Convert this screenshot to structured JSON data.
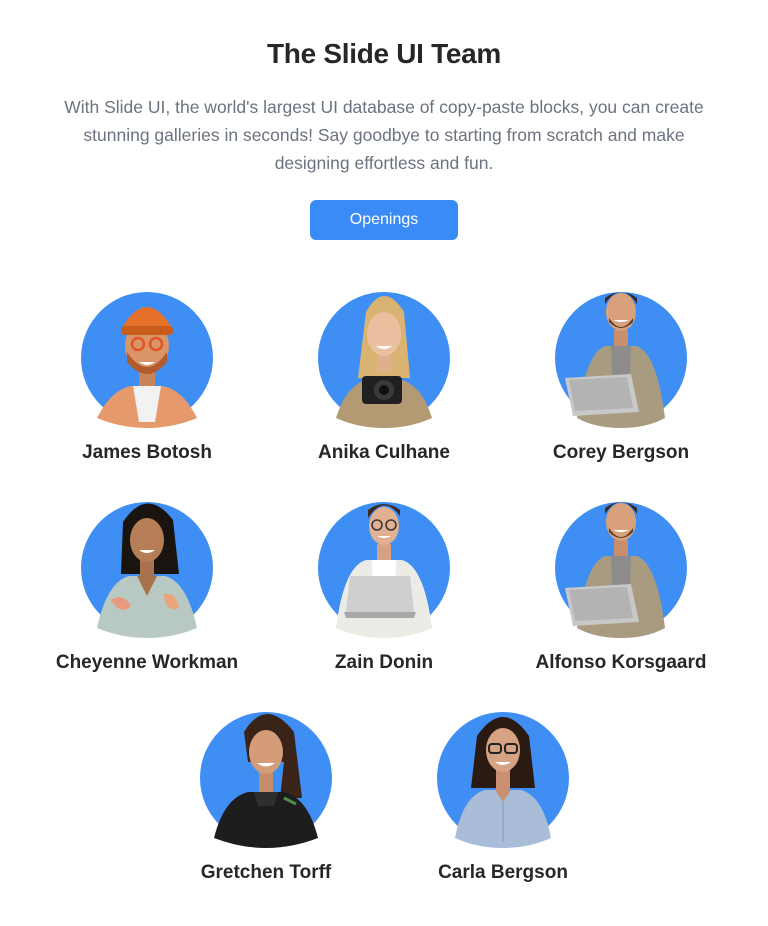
{
  "header": {
    "title": "The Slide UI Team",
    "description": "With Slide UI, the world's largest UI database of copy-paste blocks, you can create stunning galleries in seconds! Say goodbye to starting from scratch and make designing effortless and fun.",
    "openings_label": "Openings"
  },
  "colors": {
    "accent": "#3b8bf6",
    "avatar_bg": "#3f8ef3",
    "title": "#27272a",
    "body_text": "#6b7280"
  },
  "team": {
    "members": [
      {
        "name": "James Botosh",
        "avatar": "man-beanie-glasses-portrait"
      },
      {
        "name": "Anika Culhane",
        "avatar": "woman-camera-portrait"
      },
      {
        "name": "Corey Bergson",
        "avatar": "man-laptop-jacket-portrait"
      },
      {
        "name": "Cheyenne Workman",
        "avatar": "woman-floral-shirt-portrait"
      },
      {
        "name": "Zain Donin",
        "avatar": "man-glasses-laptop-portrait"
      },
      {
        "name": "Alfonso Korsgaard",
        "avatar": "man-laptop-jacket-portrait"
      },
      {
        "name": "Gretchen Torff",
        "avatar": "woman-black-jacket-portrait"
      },
      {
        "name": "Carla Bergson",
        "avatar": "woman-glasses-shirt-portrait"
      }
    ]
  }
}
